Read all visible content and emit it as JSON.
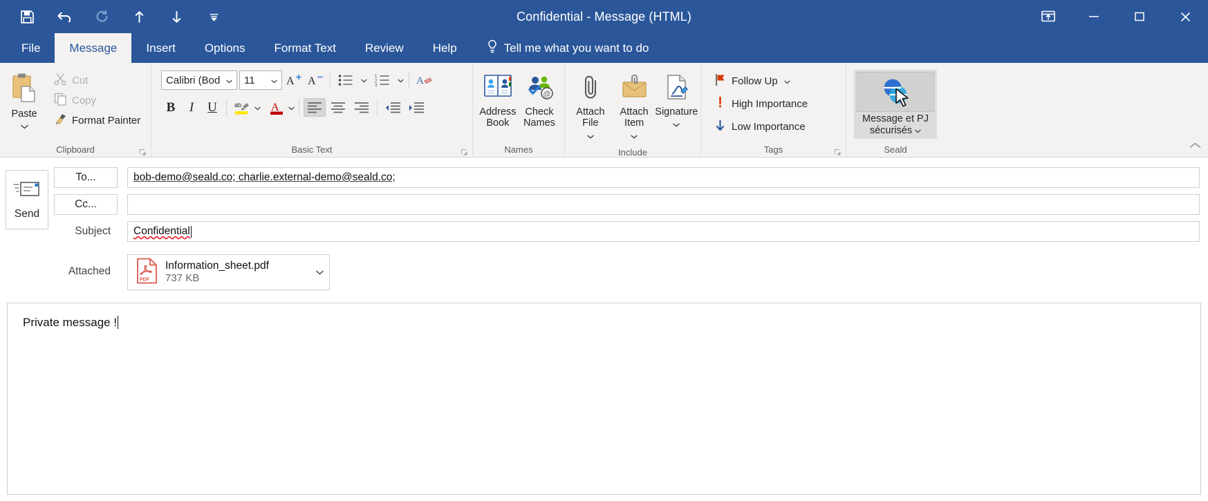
{
  "window": {
    "title": "Confidential  -  Message (HTML)",
    "accent_color": "#2b579a",
    "ribbon_bg": "#f3f2f1"
  },
  "quick_access": {
    "items": [
      {
        "name": "save-icon",
        "label": "Save"
      },
      {
        "name": "undo-icon",
        "label": "Undo"
      },
      {
        "name": "redo-icon",
        "label": "Redo"
      },
      {
        "name": "up-arrow-icon",
        "label": "Previous Item"
      },
      {
        "name": "down-arrow-icon",
        "label": "Next Item"
      },
      {
        "name": "customize-qat-icon",
        "label": "Customize Quick Access Toolbar"
      }
    ]
  },
  "window_controls": {
    "ribbon_display": "Ribbon Display Options",
    "minimize": "Minimize",
    "maximize": "Maximize",
    "close": "Close"
  },
  "tabs": [
    {
      "label": "File",
      "active": false
    },
    {
      "label": "Message",
      "active": true
    },
    {
      "label": "Insert",
      "active": false
    },
    {
      "label": "Options",
      "active": false
    },
    {
      "label": "Format Text",
      "active": false
    },
    {
      "label": "Review",
      "active": false
    },
    {
      "label": "Help",
      "active": false
    }
  ],
  "tell_me": {
    "label": "Tell me what you want to do",
    "icon": "lightbulb-icon"
  },
  "ribbon": {
    "groups": [
      {
        "label": "Clipboard"
      },
      {
        "label": "Basic Text"
      },
      {
        "label": "Names"
      },
      {
        "label": "Include"
      },
      {
        "label": "Tags"
      },
      {
        "label": "Seald"
      }
    ],
    "clipboard": {
      "paste": "Paste",
      "cut": "Cut",
      "copy": "Copy",
      "format_painter": "Format Painter"
    },
    "basic_text": {
      "font_name": "Calibri (Bod",
      "font_size": "11",
      "grow_font": "Increase Font Size",
      "shrink_font": "Decrease Font Size",
      "bullets": "Bullets",
      "numbering": "Numbering",
      "clear_formatting": "Clear All Formatting",
      "bold": "B",
      "italic": "I",
      "underline": "U",
      "highlight": "Text Highlight Color",
      "font_color": "Font Color",
      "align_left": "Align Left",
      "align_center": "Center",
      "align_right": "Align Right",
      "decrease_indent": "Decrease Indent",
      "increase_indent": "Increase Indent"
    },
    "names": {
      "address_book": "Address Book",
      "check_names": "Check Names"
    },
    "include": {
      "attach_file": "Attach File",
      "attach_item": "Attach Item",
      "signature": "Signature"
    },
    "tags": {
      "follow_up": "Follow Up",
      "high_importance": "High Importance",
      "low_importance": "Low Importance"
    },
    "seald": {
      "button_line1": "Message et PJ",
      "button_line2": "sécurisés",
      "active": true
    }
  },
  "compose": {
    "send_label": "Send",
    "to_label": "To...",
    "to_value": "bob-demo@seald.co; charlie.external-demo@seald.co;",
    "cc_label": "Cc...",
    "cc_value": "",
    "subject_label": "Subject",
    "subject_value": "Confidential",
    "attached_label": "Attached",
    "attachment": {
      "name": "Information_sheet.pdf",
      "size": "737 KB",
      "type": "pdf"
    },
    "body_text": "Private message !"
  }
}
